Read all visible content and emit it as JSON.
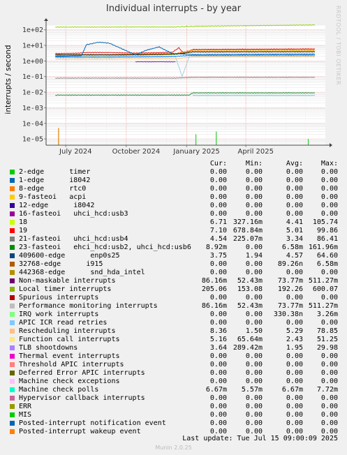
{
  "chart_data": {
    "type": "line",
    "title": "Individual interrupts - by year",
    "ylabel": "interrupts / second",
    "yscale": "log",
    "ylim": [
      4e-06,
      200
    ],
    "yticks": [
      "1e-05",
      "1e-04",
      "1e-03",
      "1e-02",
      "1e-01",
      "1e+00",
      "1e+01",
      "1e+02"
    ],
    "xlim": [
      "2024-06-01",
      "2025-07-31"
    ],
    "xticks": [
      {
        "label": "July 2024",
        "date": "2024-07-01"
      },
      {
        "label": "October 2024",
        "date": "2024-10-01"
      },
      {
        "label": "January 2025",
        "date": "2025-01-01"
      },
      {
        "label": "April 2025",
        "date": "2025-04-01"
      }
    ],
    "grid": true,
    "series": [
      {
        "name": "Local timer interrupts",
        "color": "#8fd400",
        "points": [
          [
            "2024-06-15",
            150
          ],
          [
            "2024-09-05",
            150
          ],
          [
            "2024-10-15",
            152
          ],
          [
            "2024-12-15",
            151
          ],
          [
            "2025-01-15",
            170
          ],
          [
            "2025-07-15",
            205
          ]
        ]
      },
      {
        "name": "Performance monitoring interrupts",
        "color": "#e41a1c",
        "points": [
          [
            "2024-06-15",
            3.0
          ],
          [
            "2024-07-20",
            3.2
          ],
          [
            "2024-08-01",
            3.5
          ],
          [
            "2024-09-05",
            3.5
          ],
          [
            "2024-10-15",
            3.2
          ],
          [
            "2024-12-10",
            3.6
          ],
          [
            "2024-12-20",
            7.0
          ],
          [
            "2024-12-28",
            3.0
          ],
          [
            "2025-01-10",
            5.5
          ],
          [
            "2025-07-15",
            6.0
          ]
        ]
      },
      {
        "name": "19",
        "color": "#ff8000",
        "points": [
          [
            "2024-06-15",
            2.6
          ],
          [
            "2024-09-05",
            2.6
          ],
          [
            "2024-10-15",
            2.8
          ],
          [
            "2024-12-15",
            3.0
          ],
          [
            "2025-01-10",
            5.0
          ],
          [
            "2025-07-15",
            5.2
          ]
        ]
      },
      {
        "name": "18",
        "color": "#cccc00",
        "points": [
          [
            "2024-06-15",
            2.2
          ],
          [
            "2024-09-05",
            2.2
          ],
          [
            "2024-10-15",
            2.4
          ],
          [
            "2024-12-15",
            2.6
          ],
          [
            "2025-01-10",
            4.2
          ],
          [
            "2025-07-15",
            4.4
          ]
        ]
      },
      {
        "name": "Machine check polls",
        "color": "#1e1e1e",
        "points": [
          [
            "2024-06-15",
            2.5
          ],
          [
            "2024-09-05",
            2.5
          ],
          [
            "2024-10-15",
            2.5
          ],
          [
            "2024-12-15",
            2.8
          ],
          [
            "2025-01-10",
            3.8
          ],
          [
            "2025-07-15",
            3.9
          ]
        ]
      },
      {
        "name": "1-edge",
        "color": "#0066b3",
        "points": [
          [
            "2024-06-15",
            2.0
          ],
          [
            "2024-07-25",
            2.2
          ],
          [
            "2024-08-01",
            11.0
          ],
          [
            "2024-08-20",
            16.0
          ],
          [
            "2024-09-05",
            14.0
          ],
          [
            "2024-10-15",
            2.5
          ],
          [
            "2024-11-01",
            5.0
          ],
          [
            "2024-11-20",
            8.0
          ],
          [
            "2024-12-10",
            3.0
          ],
          [
            "2025-01-10",
            2.6
          ],
          [
            "2025-07-15",
            2.8
          ]
        ]
      },
      {
        "name": "TLB shootdowns",
        "color": "#0080ff",
        "points": [
          [
            "2024-06-15",
            1.8
          ],
          [
            "2024-09-05",
            1.8
          ],
          [
            "2024-10-15",
            1.9
          ],
          [
            "2024-12-15",
            2.0
          ],
          [
            "2025-01-10",
            2.3
          ],
          [
            "2025-07-15",
            2.4
          ]
        ]
      },
      {
        "name": "Rescheduling interrupts",
        "color": "#a6cee3",
        "points": [
          [
            "2024-06-15",
            1.6
          ],
          [
            "2024-09-05",
            1.6
          ],
          [
            "2024-10-15",
            1.7
          ],
          [
            "2024-12-15",
            1.8
          ],
          [
            "2024-12-25",
            0.1
          ],
          [
            "2025-01-05",
            2.0
          ],
          [
            "2025-07-15",
            2.1
          ]
        ]
      },
      {
        "name": "Function call interrupts",
        "color": "#fdbf6f",
        "points": [
          [
            "2024-06-15",
            1.3
          ],
          [
            "2024-09-05",
            1.3
          ],
          [
            "2024-10-15",
            1.4
          ],
          [
            "2024-12-15",
            1.4
          ],
          [
            "2025-01-10",
            1.8
          ],
          [
            "2025-07-15",
            1.9
          ]
        ]
      },
      {
        "name": "21-fasteoi",
        "color": "#888888",
        "points": [
          [
            "2024-06-15",
            0.08
          ],
          [
            "2024-09-05",
            0.08
          ],
          [
            "2024-10-15",
            0.08
          ],
          [
            "2024-12-15",
            0.08
          ],
          [
            "2025-01-10",
            0.09
          ],
          [
            "2025-07-15",
            0.09
          ]
        ]
      },
      {
        "name": "23-fasteoi",
        "color": "#1a9641",
        "points": [
          [
            "2024-06-15",
            0.0065
          ],
          [
            "2024-09-05",
            0.0065
          ],
          [
            "2024-10-15",
            0.0065
          ],
          [
            "2024-12-15",
            0.0065
          ],
          [
            "2025-01-05",
            0.0065
          ],
          [
            "2025-01-10",
            0.009
          ],
          [
            "2025-07-15",
            0.009
          ]
        ]
      },
      {
        "name": "Machine check exceptions",
        "color": "#40e0d0",
        "points": [
          [
            "2025-01-10",
            0.0062
          ],
          [
            "2025-07-15",
            0.0062
          ]
        ]
      },
      {
        "name": "12-edge",
        "color": "#7b2fbf",
        "points": [
          [
            "2024-10-15",
            0.9
          ],
          [
            "2024-12-15",
            0.9
          ]
        ]
      }
    ],
    "spikes": [
      {
        "series": "8-edge",
        "color": "#e08000",
        "date": "2024-06-20",
        "value": 5e-05
      },
      {
        "series": "MIS",
        "color": "#33cc33",
        "date": "2025-01-15",
        "value": 2e-05
      },
      {
        "series": "MIS",
        "color": "#33cc33",
        "date": "2025-02-15",
        "value": 3e-05
      },
      {
        "series": "MIS",
        "color": "#33cc33",
        "date": "2025-07-05",
        "value": 1e-05
      }
    ]
  },
  "legend": {
    "headers": {
      "cur": "Cur:",
      "min": "Min:",
      "avg": "Avg:",
      "max": "Max:"
    },
    "rows": [
      {
        "color": "#00cc00",
        "label": "2-edge      timer",
        "cur": "0.00",
        "min": "0.00",
        "avg": "0.00",
        "max": "0.00"
      },
      {
        "color": "#0066b3",
        "label": "1-edge      i8042",
        "cur": "0.00",
        "min": "0.00",
        "avg": "0.00",
        "max": "0.00"
      },
      {
        "color": "#ff8000",
        "label": "8-edge      rtc0",
        "cur": "0.00",
        "min": "0.00",
        "avg": "0.00",
        "max": "0.00"
      },
      {
        "color": "#ffcc00",
        "label": "9-fasteoi   acpi",
        "cur": "0.00",
        "min": "0.00",
        "avg": "0.00",
        "max": "0.00"
      },
      {
        "color": "#330099",
        "label": "12-edge      i8042",
        "cur": "0.00",
        "min": "0.00",
        "avg": "0.00",
        "max": "0.00"
      },
      {
        "color": "#990099",
        "label": "16-fasteoi   uhci_hcd:usb3",
        "cur": "0.00",
        "min": "0.00",
        "avg": "0.00",
        "max": "0.00"
      },
      {
        "color": "#ccff00",
        "label": "18",
        "cur": "6.71",
        "min": "327.16m",
        "avg": "4.41",
        "max": "105.74"
      },
      {
        "color": "#ff0000",
        "label": "19",
        "cur": "7.10",
        "min": "678.84m",
        "avg": "5.01",
        "max": "99.86"
      },
      {
        "color": "#808080",
        "label": "21-fasteoi   uhci_hcd:usb4",
        "cur": "4.54",
        "min": "225.07m",
        "avg": "3.34",
        "max": "86.41"
      },
      {
        "color": "#008f00",
        "label": "23-fasteoi   ehci_hcd:usb2, uhci_hcd:usb6",
        "cur": "8.92m",
        "min": "0.00",
        "avg": "6.58m",
        "max": "161.96m"
      },
      {
        "color": "#00487d",
        "label": "409600-edge      enp0s25",
        "cur": "3.75",
        "min": "1.94",
        "avg": "4.57",
        "max": "64.60"
      },
      {
        "color": "#b35a00",
        "label": "32768-edge      i915",
        "cur": "0.00",
        "min": "0.00",
        "avg": "89.26n",
        "max": "6.58m"
      },
      {
        "color": "#b38f00",
        "label": "442368-edge      snd_hda_intel",
        "cur": "0.00",
        "min": "0.00",
        "avg": "0.00",
        "max": "0.00"
      },
      {
        "color": "#6b006b",
        "label": "Non-maskable interrupts",
        "cur": "86.16m",
        "min": "52.43m",
        "avg": "73.77m",
        "max": "511.27m"
      },
      {
        "color": "#8fb300",
        "label": "Local timer interrupts",
        "cur": "205.06",
        "min": "153.08",
        "avg": "192.26",
        "max": "600.07"
      },
      {
        "color": "#b30000",
        "label": "Spurious interrupts",
        "cur": "0.00",
        "min": "0.00",
        "avg": "0.00",
        "max": "0.00"
      },
      {
        "color": "#bebebe",
        "label": "Performance monitoring interrupts",
        "cur": "86.16m",
        "min": "52.43m",
        "avg": "73.77m",
        "max": "511.27m"
      },
      {
        "color": "#80ff80",
        "label": "IRQ work interrupts",
        "cur": "0.00",
        "min": "0.00",
        "avg": "330.38n",
        "max": "3.26m"
      },
      {
        "color": "#80c9ff",
        "label": "APIC ICR read retries",
        "cur": "0.00",
        "min": "0.00",
        "avg": "0.00",
        "max": "0.00"
      },
      {
        "color": "#ffc080",
        "label": "Rescheduling interrupts",
        "cur": "8.36",
        "min": "1.50",
        "avg": "5.29",
        "max": "78.85"
      },
      {
        "color": "#ffe680",
        "label": "Function call interrupts",
        "cur": "5.16",
        "min": "65.64m",
        "avg": "2.43",
        "max": "51.25"
      },
      {
        "color": "#aa80ff",
        "label": "TLB shootdowns",
        "cur": "3.64",
        "min": "289.42m",
        "avg": "1.95",
        "max": "29.98"
      },
      {
        "color": "#ee00cc",
        "label": "Thermal event interrupts",
        "cur": "0.00",
        "min": "0.00",
        "avg": "0.00",
        "max": "0.00"
      },
      {
        "color": "#ff8080",
        "label": "Threshold APIC interrupts",
        "cur": "0.00",
        "min": "0.00",
        "avg": "0.00",
        "max": "0.00"
      },
      {
        "color": "#666600",
        "label": "Deferred Error APIC interrupts",
        "cur": "0.00",
        "min": "0.00",
        "avg": "0.00",
        "max": "0.00"
      },
      {
        "color": "#ffbfff",
        "label": "Machine check exceptions",
        "cur": "0.00",
        "min": "0.00",
        "avg": "0.00",
        "max": "0.00"
      },
      {
        "color": "#00ffcc",
        "label": "Machine check polls",
        "cur": "6.67m",
        "min": "5.57m",
        "avg": "6.67m",
        "max": "7.72m"
      },
      {
        "color": "#cc6699",
        "label": "Hypervisor callback interrupts",
        "cur": "0.00",
        "min": "0.00",
        "avg": "0.00",
        "max": "0.00"
      },
      {
        "color": "#999900",
        "label": "ERR",
        "cur": "0.00",
        "min": "0.00",
        "avg": "0.00",
        "max": "0.00"
      },
      {
        "color": "#00cc00",
        "label": "MIS",
        "cur": "0.00",
        "min": "0.00",
        "avg": "0.00",
        "max": "0.00"
      },
      {
        "color": "#0066b3",
        "label": "Posted-interrupt notification event",
        "cur": "0.00",
        "min": "0.00",
        "avg": "0.00",
        "max": "0.00"
      },
      {
        "color": "#ff8000",
        "label": "Posted-interrupt wakeup event",
        "cur": "0.00",
        "min": "0.00",
        "avg": "0.00",
        "max": "0.00"
      }
    ]
  },
  "last_update": "Last update:  Tue Jul 15 09:00:09 2025",
  "munin_version": "Munin 2.0.25",
  "watermark": "RRDTOOL / TOBI OETIKER"
}
